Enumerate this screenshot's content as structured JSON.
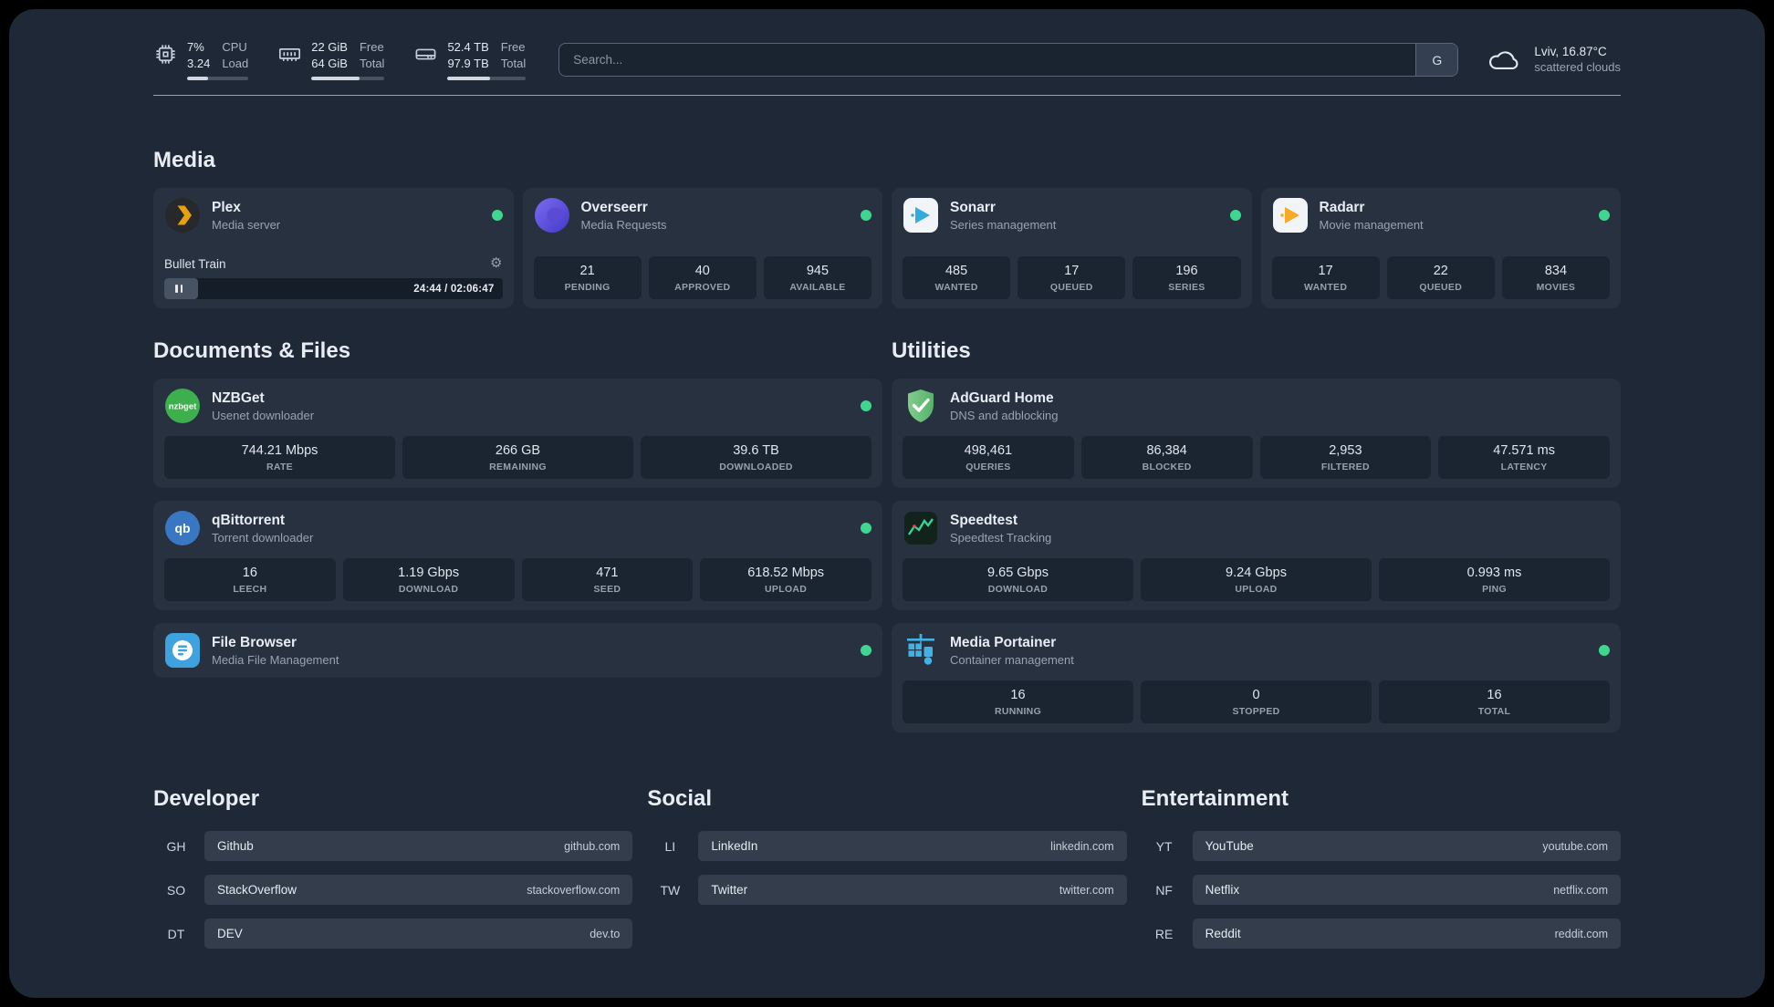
{
  "topbar": {
    "cpu": {
      "value_top": "7%",
      "value_bottom": "3.24",
      "label_top": "CPU",
      "label_bottom": "Load",
      "bar_percent": 34
    },
    "memory": {
      "value_top": "22 GiB",
      "value_bottom": "64 GiB",
      "label_top": "Free",
      "label_bottom": "Total",
      "bar_percent": 66
    },
    "disk": {
      "value_top": "52.4 TB",
      "value_bottom": "97.9 TB",
      "label_top": "Free",
      "label_bottom": "Total",
      "bar_percent": 54
    },
    "search": {
      "placeholder": "Search...",
      "provider_label": "G"
    },
    "weather": {
      "location": "Lviv, 16.87°C",
      "condition": "scattered clouds"
    }
  },
  "colors": {
    "status_online": "#3fd68f",
    "plex_accent": "#e5a00d"
  },
  "sections": {
    "media": {
      "title": "Media",
      "plex": {
        "name": "Plex",
        "subtitle": "Media server",
        "player": {
          "title": "Bullet Train",
          "time": "24:44 / 02:06:47",
          "progress_percent": 10
        }
      },
      "overseerr": {
        "name": "Overseerr",
        "subtitle": "Media Requests",
        "stats": [
          {
            "value": "21",
            "label": "PENDING"
          },
          {
            "value": "40",
            "label": "APPROVED"
          },
          {
            "value": "945",
            "label": "AVAILABLE"
          }
        ]
      },
      "sonarr": {
        "name": "Sonarr",
        "subtitle": "Series management",
        "stats": [
          {
            "value": "485",
            "label": "WANTED"
          },
          {
            "value": "17",
            "label": "QUEUED"
          },
          {
            "value": "196",
            "label": "SERIES"
          }
        ]
      },
      "radarr": {
        "name": "Radarr",
        "subtitle": "Movie management",
        "stats": [
          {
            "value": "17",
            "label": "WANTED"
          },
          {
            "value": "22",
            "label": "QUEUED"
          },
          {
            "value": "834",
            "label": "MOVIES"
          }
        ]
      }
    },
    "documents": {
      "title": "Documents & Files",
      "nzbget": {
        "name": "NZBGet",
        "subtitle": "Usenet downloader",
        "stats": [
          {
            "value": "744.21 Mbps",
            "label": "RATE"
          },
          {
            "value": "266 GB",
            "label": "REMAINING"
          },
          {
            "value": "39.6 TB",
            "label": "DOWNLOADED"
          }
        ]
      },
      "qbittorrent": {
        "name": "qBittorrent",
        "subtitle": "Torrent downloader",
        "stats": [
          {
            "value": "16",
            "label": "LEECH"
          },
          {
            "value": "1.19 Gbps",
            "label": "DOWNLOAD"
          },
          {
            "value": "471",
            "label": "SEED"
          },
          {
            "value": "618.52 Mbps",
            "label": "UPLOAD"
          }
        ]
      },
      "filebrowser": {
        "name": "File Browser",
        "subtitle": "Media File Management"
      }
    },
    "utilities": {
      "title": "Utilities",
      "adguard": {
        "name": "AdGuard Home",
        "subtitle": "DNS and adblocking",
        "stats": [
          {
            "value": "498,461",
            "label": "QUERIES"
          },
          {
            "value": "86,384",
            "label": "BLOCKED"
          },
          {
            "value": "2,953",
            "label": "FILTERED"
          },
          {
            "value": "47.571 ms",
            "label": "LATENCY"
          }
        ]
      },
      "speedtest": {
        "name": "Speedtest",
        "subtitle": "Speedtest Tracking",
        "stats": [
          {
            "value": "9.65 Gbps",
            "label": "DOWNLOAD"
          },
          {
            "value": "9.24 Gbps",
            "label": "UPLOAD"
          },
          {
            "value": "0.993 ms",
            "label": "PING"
          }
        ]
      },
      "portainer": {
        "name": "Media Portainer",
        "subtitle": "Container management",
        "stats": [
          {
            "value": "16",
            "label": "RUNNING"
          },
          {
            "value": "0",
            "label": "STOPPED"
          },
          {
            "value": "16",
            "label": "TOTAL"
          }
        ]
      }
    },
    "bookmarks": {
      "developer": {
        "title": "Developer",
        "items": [
          {
            "abbr": "GH",
            "name": "Github",
            "url": "github.com"
          },
          {
            "abbr": "SO",
            "name": "StackOverflow",
            "url": "stackoverflow.com"
          },
          {
            "abbr": "DT",
            "name": "DEV",
            "url": "dev.to"
          }
        ]
      },
      "social": {
        "title": "Social",
        "items": [
          {
            "abbr": "LI",
            "name": "LinkedIn",
            "url": "linkedin.com"
          },
          {
            "abbr": "TW",
            "name": "Twitter",
            "url": "twitter.com"
          }
        ]
      },
      "entertainment": {
        "title": "Entertainment",
        "items": [
          {
            "abbr": "YT",
            "name": "YouTube",
            "url": "youtube.com"
          },
          {
            "abbr": "NF",
            "name": "Netflix",
            "url": "netflix.com"
          },
          {
            "abbr": "RE",
            "name": "Reddit",
            "url": "reddit.com"
          }
        ]
      }
    }
  }
}
